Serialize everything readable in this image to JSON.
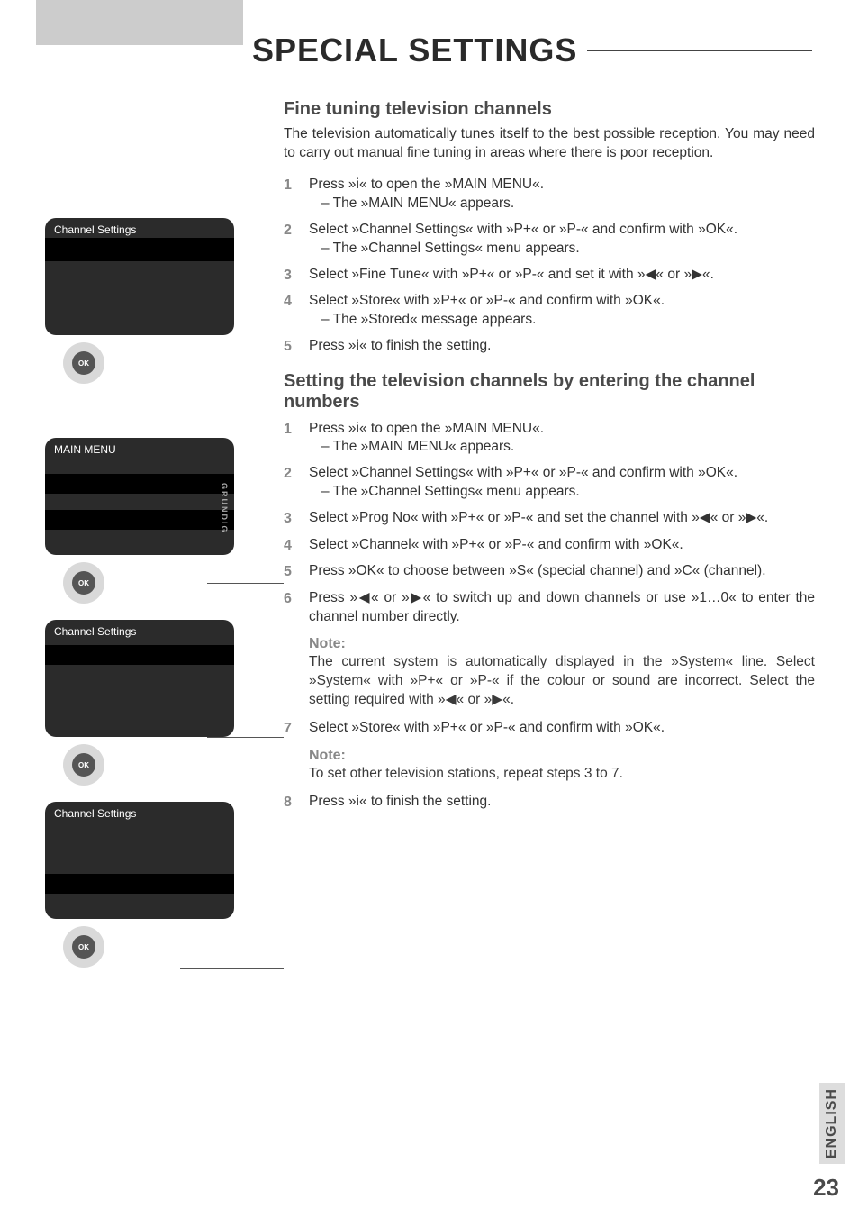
{
  "title": "SPECIAL SETTINGS",
  "screens": {
    "s1": "Channel Settings",
    "s2": "MAIN MENU",
    "s2_brand": "GRUNDIG",
    "s3": "Channel Settings",
    "s4": "Channel Settings"
  },
  "ok_label": "OK",
  "section1": {
    "heading": "Fine tuning television channels",
    "intro": "The television automatically tunes itself to the best possible reception. You may need to carry out manual fine tuning in areas where there is poor reception.",
    "steps": {
      "s1_a": "Press »i« to open the »MAIN MENU«.",
      "s1_b": "– The »MAIN MENU« appears.",
      "s2_a": "Select »Channel Settings« with »P+« or »P-« and confirm with »OK«.",
      "s2_b": "– The »Channel Settings« menu appears.",
      "s3": "Select »Fine Tune« with »P+« or »P-« and set it with »◀« or »▶«.",
      "s4_a": "Select »Store« with »P+« or »P-« and confirm with »OK«.",
      "s4_b": "– The »Stored« message appears.",
      "s5": "Press »i« to finish the setting."
    }
  },
  "section2": {
    "heading": "Setting the television channels by entering the channel numbers",
    "steps": {
      "s1_a": "Press »i« to open the »MAIN MENU«.",
      "s1_b": "– The »MAIN MENU« appears.",
      "s2_a": "Select »Channel Settings« with »P+« or »P-« and confirm with »OK«.",
      "s2_b": "– The »Channel Settings« menu appears.",
      "s3": "Select »Prog No« with »P+« or »P-« and set the channel with »◀« or »▶«.",
      "s4": "Select »Channel« with »P+« or »P-« and confirm with »OK«.",
      "s5": "Press »OK« to choose between »S« (special channel) and »C« (channel).",
      "s6": "Press »◀« or »▶« to switch up and down channels or use »1…0« to enter the channel number directly.",
      "note1_label": "Note:",
      "note1_body": "The current system is automatically displayed in the »System« line. Select »System« with »P+« or »P-« if the colour or sound are incorrect. Select the setting required with »◀« or »▶«.",
      "s7": "Select »Store« with »P+« or »P-« and confirm with »OK«.",
      "note2_label": "Note:",
      "note2_body": "To set other television stations, repeat steps 3 to 7.",
      "s8": "Press »i« to finish the setting."
    }
  },
  "footer": {
    "lang": "ENGLISH",
    "page": "23"
  }
}
